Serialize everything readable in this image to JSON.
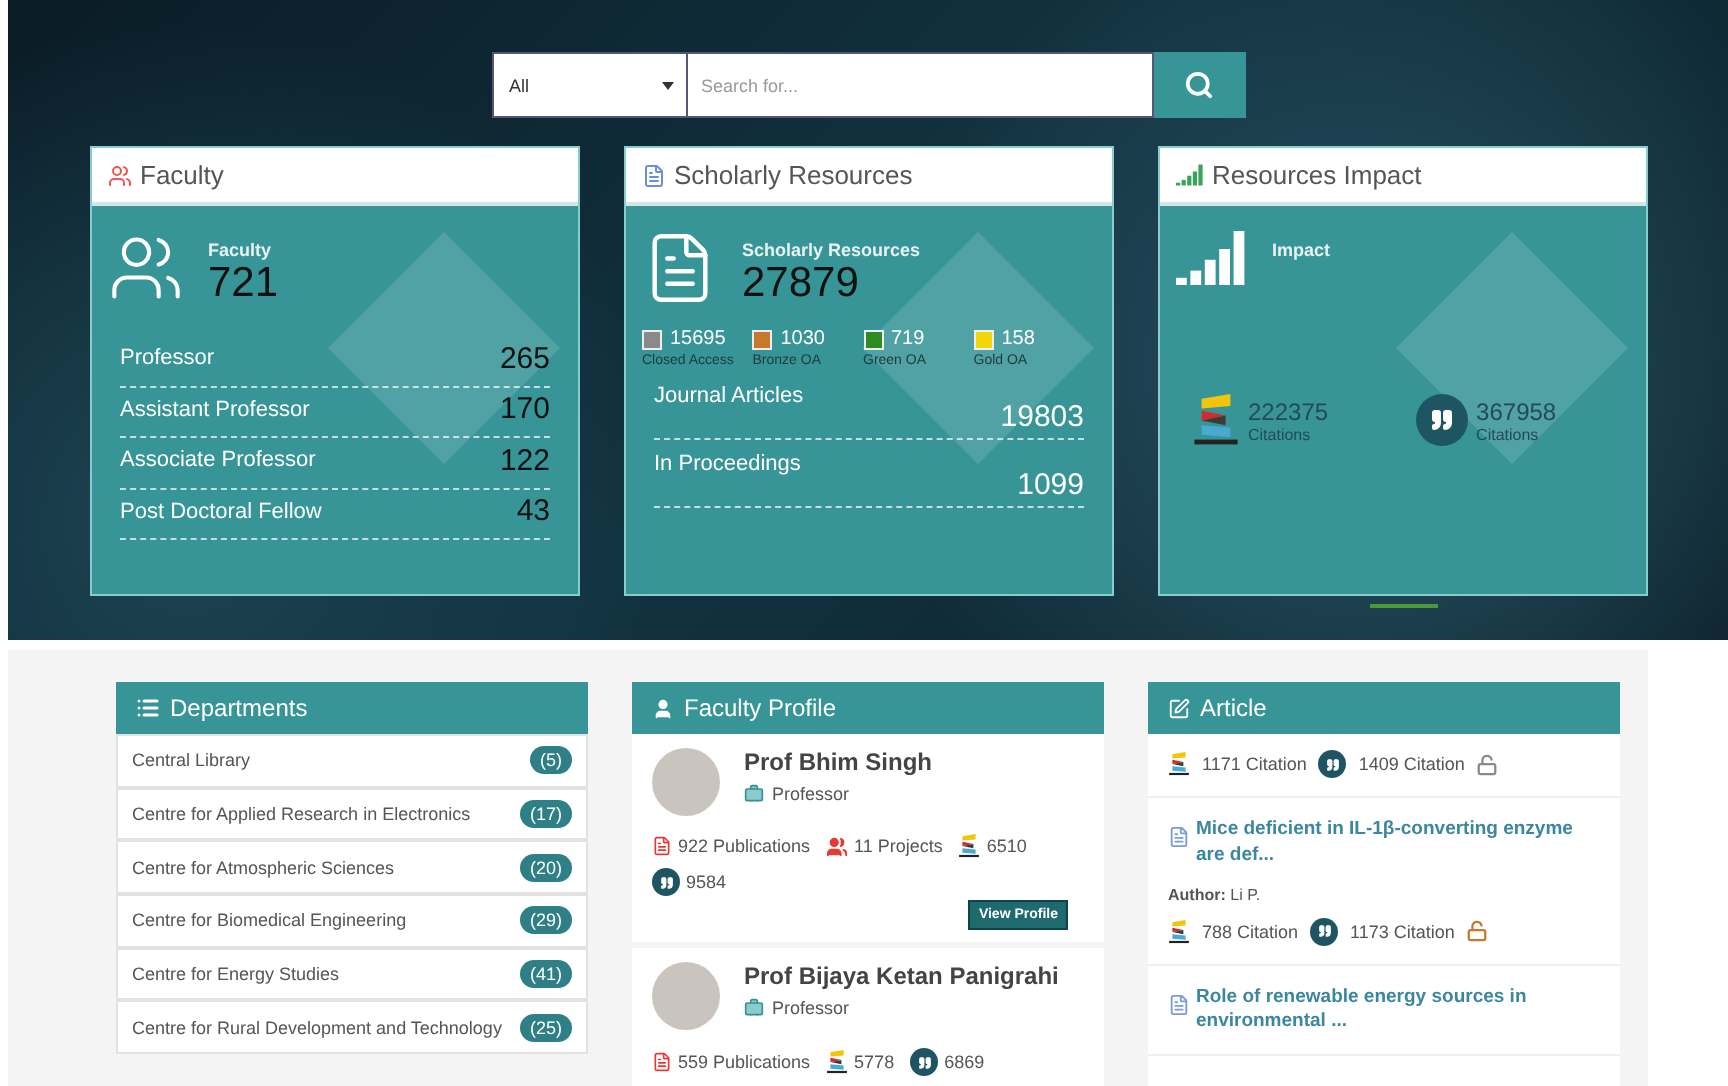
{
  "search": {
    "category": "All",
    "placeholder": "Search for..."
  },
  "faculty_card": {
    "title": "Faculty",
    "label": "Faculty",
    "total": "721",
    "rows": [
      {
        "label": "Professor",
        "value": "265"
      },
      {
        "label": "Assistant Professor",
        "value": "170"
      },
      {
        "label": "Associate Professor",
        "value": "122"
      },
      {
        "label": "Post Doctoral Fellow",
        "value": "43"
      }
    ]
  },
  "resources_card": {
    "title": "Scholarly Resources",
    "label": "Scholarly Resources",
    "total": "27879",
    "legend": [
      {
        "value": "15695",
        "label": "Closed Access",
        "color": "#8a8a8a"
      },
      {
        "value": "1030",
        "label": "Bronze OA",
        "color": "#c8782a"
      },
      {
        "value": "719",
        "label": "Green OA",
        "color": "#2e8b22"
      },
      {
        "value": "158",
        "label": "Gold OA",
        "color": "#f2d60c"
      }
    ],
    "rows": [
      {
        "label": "Journal Articles",
        "value": "19803"
      },
      {
        "label": "In Proceedings",
        "value": "1099"
      }
    ]
  },
  "impact_card": {
    "title": "Resources Impact",
    "label": "Impact",
    "stats": [
      {
        "kind": "crossref",
        "value": "222375",
        "label": "Citations"
      },
      {
        "kind": "quote",
        "value": "367958",
        "label": "Citations"
      }
    ]
  },
  "departments": {
    "title": "Departments",
    "items": [
      {
        "name": "Central Library",
        "count": "(5)"
      },
      {
        "name": "Centre for Applied Research in Electronics",
        "count": "(17)"
      },
      {
        "name": "Centre for Atmospheric Sciences",
        "count": "(20)"
      },
      {
        "name": "Centre for Biomedical Engineering",
        "count": "(29)"
      },
      {
        "name": "Centre for Energy Studies",
        "count": "(41)"
      },
      {
        "name": "Centre for Rural Development and Technology",
        "count": "(25)"
      }
    ]
  },
  "faculty_profile": {
    "title": "Faculty Profile",
    "people": [
      {
        "name": "Prof Bhim Singh",
        "position": "Professor",
        "stats": [
          {
            "kind": "publications",
            "text": "922 Publications"
          },
          {
            "kind": "projects",
            "text": "11 Projects"
          },
          {
            "kind": "crossref",
            "text": "6510"
          },
          {
            "kind": "quote",
            "text": "9584"
          }
        ],
        "action": "View Profile"
      },
      {
        "name": "Prof Bijaya Ketan Panigrahi",
        "position": "Professor",
        "stats": [
          {
            "kind": "publications",
            "text": "559 Publications"
          },
          {
            "kind": "crossref",
            "text": "5778"
          },
          {
            "kind": "quote",
            "text": "6869"
          }
        ]
      }
    ]
  },
  "articles": {
    "title": "Article",
    "items": [
      {
        "crossref": "1171 Citation",
        "citations": "1409 Citation",
        "color": "#8a8a8a"
      },
      {
        "title": "Mice deficient in IL-1β-converting enzyme are def...",
        "author": "**Author:** Li P.",
        "crossref": "788 Citation",
        "citations": "1173 Citation",
        "color": "#c8782a"
      },
      {
        "title": "Role of renewable energy sources in environmental ..."
      }
    ]
  }
}
